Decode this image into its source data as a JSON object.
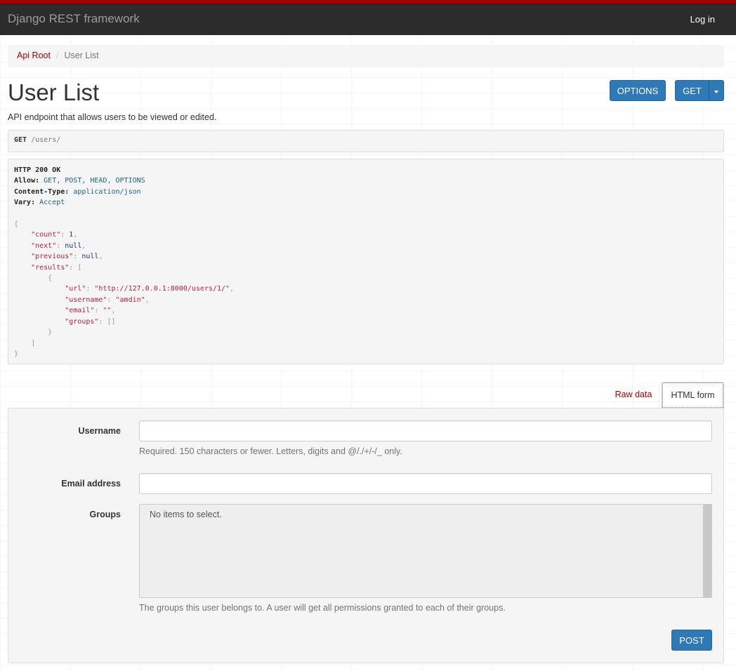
{
  "navbar": {
    "brand": "Django REST framework",
    "login": "Log in"
  },
  "breadcrumb": {
    "root": "Api Root",
    "current": "User List"
  },
  "page": {
    "title": "User List",
    "description": "API endpoint that allows users to be viewed or edited.",
    "options_button": "OPTIONS",
    "get_button": "GET"
  },
  "request": {
    "method": "GET",
    "path": "/users/"
  },
  "response": {
    "status": "HTTP 200 OK",
    "headers": [
      {
        "key": "Allow:",
        "value": "GET, POST, HEAD, OPTIONS"
      },
      {
        "key": "Content-Type:",
        "value": "application/json"
      },
      {
        "key": "Vary:",
        "value": "Accept"
      }
    ],
    "body": {
      "count_key": "\"count\"",
      "count_val": "1",
      "next_key": "\"next\"",
      "next_val": "null",
      "previous_key": "\"previous\"",
      "previous_val": "null",
      "results_key": "\"results\"",
      "url_key": "\"url\"",
      "url_val": "\"http://127.0.0.1:8000/users/1/\"",
      "username_key": "\"username\"",
      "username_val": "\"amdin\"",
      "email_key": "\"email\"",
      "email_val": "\"\"",
      "groups_key": "\"groups\"",
      "groups_val": "[]"
    }
  },
  "tabs": {
    "raw": "Raw data",
    "html": "HTML form"
  },
  "form": {
    "username_label": "Username",
    "username_value": "",
    "username_help": "Required. 150 characters or fewer. Letters, digits and @/./+/-/_ only.",
    "email_label": "Email address",
    "email_value": "",
    "groups_label": "Groups",
    "groups_empty": "No items to select.",
    "groups_help": "The groups this user belongs to. A user will get all permissions granted to each of their groups.",
    "post_button": "POST"
  }
}
